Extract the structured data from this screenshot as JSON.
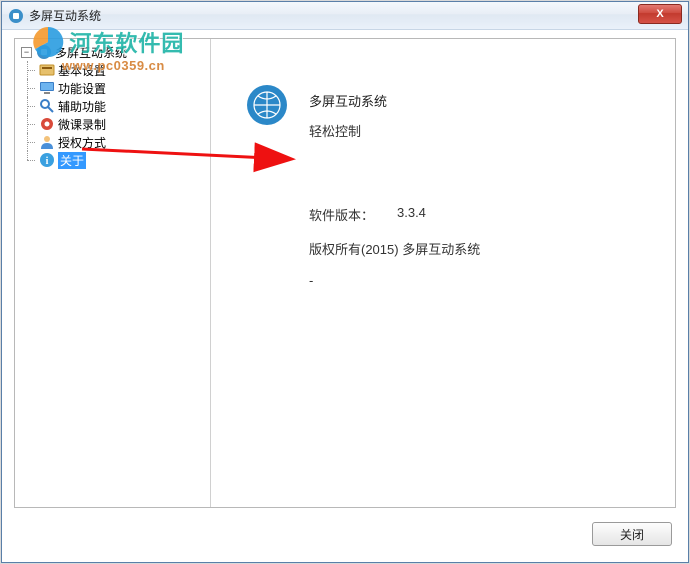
{
  "window": {
    "title": "多屏互动系统"
  },
  "tree": {
    "root_label": "多屏互动系统",
    "items": [
      {
        "label": "基本设置",
        "icon": "settings"
      },
      {
        "label": "功能设置",
        "icon": "monitor"
      },
      {
        "label": "辅助功能",
        "icon": "search"
      },
      {
        "label": "微课录制",
        "icon": "record"
      },
      {
        "label": "授权方式",
        "icon": "user"
      },
      {
        "label": "关于",
        "icon": "info",
        "selected": true
      }
    ]
  },
  "detail": {
    "app_name": "多屏互动系统",
    "slogan": "轻松控制",
    "version_label": "软件版本：",
    "version_value": "3.3.4",
    "copyright": "版权所有(2015) 多屏互动系统",
    "extra": "-"
  },
  "footer": {
    "close_btn": "关闭"
  },
  "watermark": {
    "text_main": "河东软件园",
    "text_sub": "www.pc0359.cn"
  },
  "close_x": "X"
}
